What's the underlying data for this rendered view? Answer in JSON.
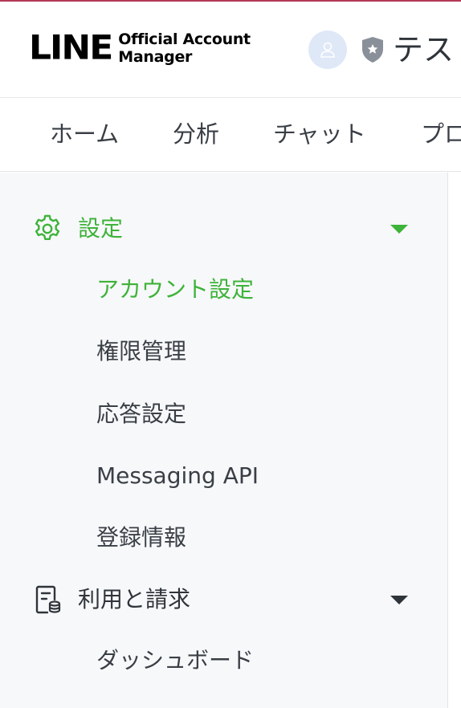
{
  "header": {
    "logo_main": "LINE",
    "logo_sub_line1": "Official Account",
    "logo_sub_line2": "Manager",
    "account_name": "テスト"
  },
  "nav": {
    "tabs": [
      {
        "label": "ホーム"
      },
      {
        "label": "分析"
      },
      {
        "label": "チャット"
      },
      {
        "label": "プロ"
      }
    ]
  },
  "sidebar": {
    "sections": [
      {
        "label": "設定",
        "icon": "gear-icon",
        "expanded": true,
        "active": true,
        "items": [
          {
            "label": "アカウント設定",
            "active": true
          },
          {
            "label": "権限管理",
            "active": false
          },
          {
            "label": "応答設定",
            "active": false
          },
          {
            "label": "Messaging API",
            "active": false
          },
          {
            "label": "登録情報",
            "active": false
          }
        ]
      },
      {
        "label": "利用と請求",
        "icon": "billing-document-icon",
        "expanded": true,
        "active": false,
        "items": [
          {
            "label": "ダッシュボード",
            "active": false
          }
        ]
      }
    ]
  },
  "colors": {
    "accent_green": "#3eb33a",
    "top_bar": "#b23a57",
    "sidebar_bg": "#f7f8fa",
    "avatar_bg": "#dfe8f7"
  }
}
